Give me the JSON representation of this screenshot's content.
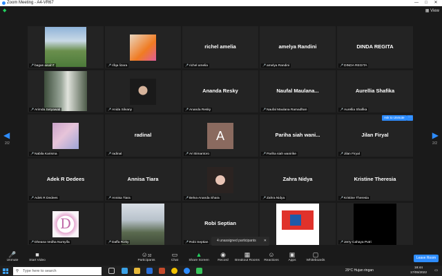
{
  "window": {
    "title": "Zoom Meeting - A4-VR67",
    "minimize": "—",
    "maximize": "□",
    "close": "✕"
  },
  "top": {
    "view_label": "View"
  },
  "nav": {
    "left_page": "2/2",
    "right_page": "2/2"
  },
  "tiles": [
    {
      "row": 0,
      "col": 0,
      "name": "",
      "label": "bagas aisahT",
      "type": "photo",
      "photo": "sports-field"
    },
    {
      "row": 0,
      "col": 1,
      "name": "",
      "label": "rifqa lizara",
      "type": "photo",
      "photo": "girl-orange"
    },
    {
      "row": 0,
      "col": 2,
      "name": "richel amelia",
      "label": "richel amelia",
      "type": "name"
    },
    {
      "row": 0,
      "col": 3,
      "name": "amelya Randini",
      "label": "amelya Randini",
      "type": "name"
    },
    {
      "row": 0,
      "col": 4,
      "name": "DINDA REGITA",
      "label": "DINDA REGITA",
      "type": "name"
    },
    {
      "row": 1,
      "col": 0,
      "name": "",
      "label": "Arimda Setyawati",
      "type": "photo",
      "photo": "stairs"
    },
    {
      "row": 1,
      "col": 1,
      "name": "",
      "label": "Anida Silvany",
      "type": "photo",
      "photo": "hijab"
    },
    {
      "row": 1,
      "col": 2,
      "name": "Ananda Resky",
      "label": "Ananda Resky",
      "type": "name"
    },
    {
      "row": 1,
      "col": 3,
      "name": "Naufal  Maulana...",
      "label": "Naufal Maulana Ramadhan",
      "type": "name"
    },
    {
      "row": 1,
      "col": 4,
      "name": "Aurellia Shafika",
      "label": "Aurellia Shafika",
      "type": "name"
    },
    {
      "row": 2,
      "col": 0,
      "name": "",
      "label": "Nabila Karisma",
      "type": "photo",
      "photo": "pink-sky"
    },
    {
      "row": 2,
      "col": 1,
      "name": "radinal",
      "label": "radinal",
      "type": "name"
    },
    {
      "row": 2,
      "col": 2,
      "name": "",
      "label": "Ari Bimantoro",
      "type": "avatar",
      "initial": "A"
    },
    {
      "row": 2,
      "col": 3,
      "name": "Pariha siah wani...",
      "label": "Pariha siah wanirike",
      "type": "name"
    },
    {
      "row": 2,
      "col": 4,
      "name": "Jilan Firyal",
      "label": "Jilan Firyal",
      "type": "name"
    },
    {
      "row": 3,
      "col": 0,
      "name": "Adek R Dedees",
      "label": "Adek R Dedees",
      "type": "name"
    },
    {
      "row": 3,
      "col": 1,
      "name": "Annisa Tiara",
      "label": "Annisa Tiara",
      "type": "name"
    },
    {
      "row": 3,
      "col": 2,
      "name": "",
      "label": "Belva Ananda Shara",
      "type": "photo",
      "photo": "flower-girl"
    },
    {
      "row": 3,
      "col": 3,
      "name": "Zahra Nidya",
      "label": "Zahra Nidya",
      "type": "name"
    },
    {
      "row": 3,
      "col": 4,
      "name": "Kristine Theresia",
      "label": "Kristine Theresia",
      "type": "name"
    },
    {
      "row": 4,
      "col": 0,
      "name": "",
      "label": "Dheana Vedha Nursyifa",
      "type": "photo",
      "photo": "letter-d"
    },
    {
      "row": 4,
      "col": 1,
      "name": "",
      "label": "Daffa Rizky",
      "type": "photo",
      "photo": "two-men"
    },
    {
      "row": 4,
      "col": 2,
      "name": "Robi Septian",
      "label": "Robi Septian",
      "type": "name"
    },
    {
      "row": 4,
      "col": 3,
      "name": "",
      "label": "",
      "type": "photo",
      "photo": "logo"
    },
    {
      "row": 4,
      "col": 4,
      "name": "",
      "label": "Jerry Cahaya Putri",
      "type": "photo",
      "photo": "black"
    }
  ],
  "overlay": {
    "unassigned": "4 unassigned participants",
    "ask_unmute": "Ask to Unmute",
    "ask_more": "···"
  },
  "toolbar": {
    "unmute": "Unmute",
    "start_video": "Start Video",
    "participants": "Participants",
    "participants_count": "32",
    "chat": "Chat",
    "share_screen": "Share Screen",
    "record": "Record",
    "breakout": "Breakout Rooms",
    "reactions": "Reactions",
    "apps": "Apps",
    "whiteboards": "Whiteboards",
    "leave": "Leave Room"
  },
  "taskbar": {
    "search_placeholder": "Type here to search",
    "weather": "29°C  Hujan ringan",
    "time": "18:44",
    "date": "17/05/2022"
  },
  "colors": {
    "accent": "#2d8cff",
    "tile_bg": "#232323",
    "mute_red": "#e02828",
    "share_green": "#23d160"
  }
}
